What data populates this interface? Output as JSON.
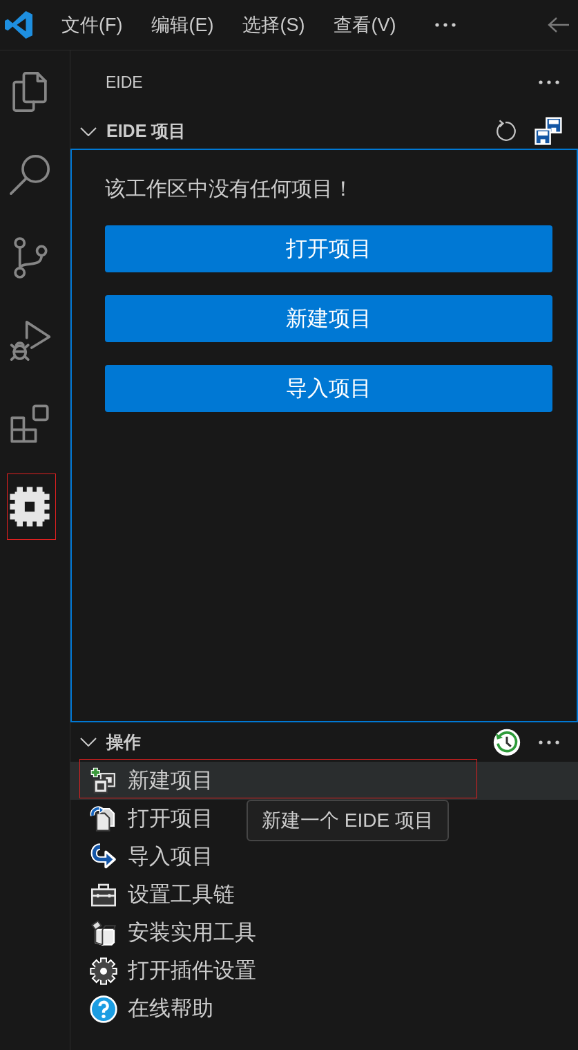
{
  "menu_bar": {
    "items": [
      "文件(F)",
      "编辑(E)",
      "选择(S)",
      "查看(V)"
    ]
  },
  "activity_bar": {
    "items": [
      {
        "kind": "explorer",
        "selected": false,
        "marked": false
      },
      {
        "kind": "search",
        "selected": false,
        "marked": false
      },
      {
        "kind": "source_control",
        "selected": false,
        "marked": false
      },
      {
        "kind": "run_debug",
        "selected": false,
        "marked": false
      },
      {
        "kind": "extensions",
        "selected": false,
        "marked": false
      },
      {
        "kind": "chip",
        "selected": true,
        "marked": true
      }
    ]
  },
  "sidebar": {
    "title": "EIDE"
  },
  "projects": {
    "title": "EIDE 项目",
    "expanded": true,
    "focused": true,
    "message": "该工作区中没有任何项目！",
    "buttons": [
      "打开项目",
      "新建项目",
      "导入项目"
    ]
  },
  "actions": {
    "title": "操作",
    "expanded": true,
    "items": [
      {
        "kind": "new",
        "label": "新建项目",
        "selected": true,
        "marked": true
      },
      {
        "kind": "open",
        "label": "打开项目",
        "selected": false,
        "marked": false
      },
      {
        "kind": "import",
        "label": "导入项目",
        "selected": false,
        "marked": false
      },
      {
        "kind": "toolchain",
        "label": "设置工具链",
        "selected": false,
        "marked": false
      },
      {
        "kind": "install",
        "label": "安装实用工具",
        "selected": false,
        "marked": false
      },
      {
        "kind": "settings",
        "label": "打开插件设置",
        "selected": false,
        "marked": false
      },
      {
        "kind": "help",
        "label": "在线帮助",
        "selected": false,
        "marked": false
      }
    ],
    "tooltip": "新建一个 EIDE 项目"
  }
}
